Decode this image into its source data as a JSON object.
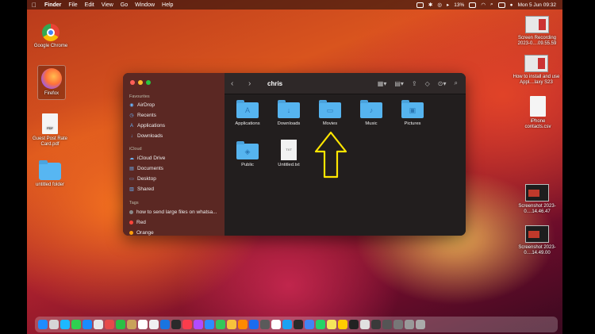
{
  "menubar": {
    "app": "Finder",
    "items": [
      "File",
      "Edit",
      "View",
      "Go",
      "Window",
      "Help"
    ],
    "battery": "13%",
    "datetime": "Mon 5 Jun  09:32"
  },
  "desktop": {
    "left_icons": [
      {
        "label": "Google Chrome",
        "icon": "chrome-icon"
      },
      {
        "label": "Firefox",
        "icon": "firefox-icon"
      },
      {
        "label": "Guest Post Rate Card.pdf",
        "icon": "pdf-icon",
        "tag": "PDF"
      },
      {
        "label": "untitled folder",
        "icon": "folder-icon"
      }
    ],
    "right_icons": [
      {
        "label": "Screen Recording 2023-0....09.55.59"
      },
      {
        "label": "How to install and use Appl....laxy S23"
      },
      {
        "label": "iPhone contacts.csv"
      },
      {
        "label": "Screenshot 2023-0....14.46.47"
      },
      {
        "label": "Screenshot 2023-0....14.49.00"
      }
    ]
  },
  "finder": {
    "title": "chris",
    "sidebar": {
      "favourites_header": "Favourites",
      "favourites": [
        "AirDrop",
        "Recents",
        "Applications",
        "Downloads"
      ],
      "icloud_header": "iCloud",
      "icloud": [
        "iCloud Drive",
        "Documents",
        "Desktop",
        "Shared"
      ],
      "tags_header": "Tags",
      "tags": [
        {
          "label": "how to send large files on whatsa...",
          "color": "#8a8a8a"
        },
        {
          "label": "Red",
          "color": "#ff453a"
        },
        {
          "label": "Orange",
          "color": "#ff9f0a"
        }
      ]
    },
    "files": [
      {
        "label": "Applications",
        "glyph": "A"
      },
      {
        "label": "Downloads",
        "glyph": "↓"
      },
      {
        "label": "Movies",
        "glyph": "▭"
      },
      {
        "label": "Music",
        "glyph": "♪"
      },
      {
        "label": "Pictures",
        "glyph": "▣"
      },
      {
        "label": "Public",
        "glyph": "◈"
      },
      {
        "label": "Untitled.txt",
        "glyph": "TXT"
      }
    ]
  },
  "annotation": {
    "arrow_color": "#ffe600"
  },
  "dock_colors": [
    "#1e8cff",
    "#d6d6d6",
    "#1db8ff",
    "#2fcf50",
    "#1a8cff",
    "#e8e8e8",
    "#e64a4a",
    "#2cbf45",
    "#c9a25a",
    "#ffffff",
    "#f0f0f0",
    "#1a74e0",
    "#2a2a2a",
    "#fa3c4c",
    "#b04bff",
    "#2d8cff",
    "#34c759",
    "#f7c23c",
    "#ff8a00",
    "#1a6cf0",
    "#5a5a5a",
    "#ffffff",
    "#1da1f2",
    "#2a2a2a",
    "#4285f4",
    "#25d366",
    "#f5e65c",
    "#ffcc00",
    "#222222",
    "#e0e0e0",
    "#3a3a3a",
    "#555555",
    "#777777",
    "#999999",
    "#aaaaaa"
  ]
}
